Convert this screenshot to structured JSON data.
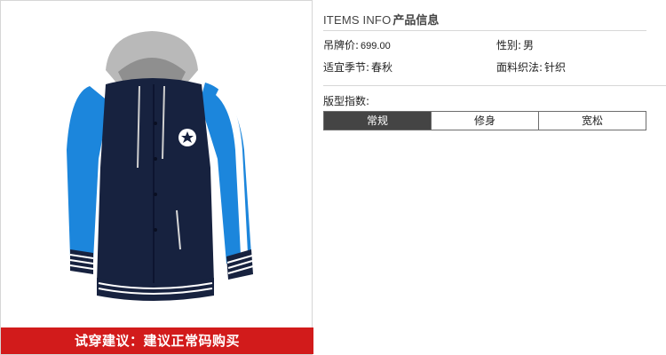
{
  "info": {
    "title_en": "ITEMS INFO",
    "title_cn": "产品信息",
    "price_label": "吊牌价:",
    "price_value": "699.00",
    "gender_label": "性别:",
    "gender_value": "男",
    "season_label": "适宜季节:",
    "season_value": "春秋",
    "fabric_label": "面料织法:",
    "fabric_value": "针织"
  },
  "fit": {
    "label": "版型指数:",
    "options": [
      "常规",
      "修身",
      "宽松"
    ],
    "selected": "常规"
  },
  "banner": {
    "text": "试穿建议：建议正常码购买"
  },
  "colors": {
    "banner_red": "#d21b1b",
    "active_option": "#444444",
    "jacket_navy": "#17223f",
    "jacket_blue": "#1c86dc",
    "hood_gray": "#bdbdbd"
  }
}
